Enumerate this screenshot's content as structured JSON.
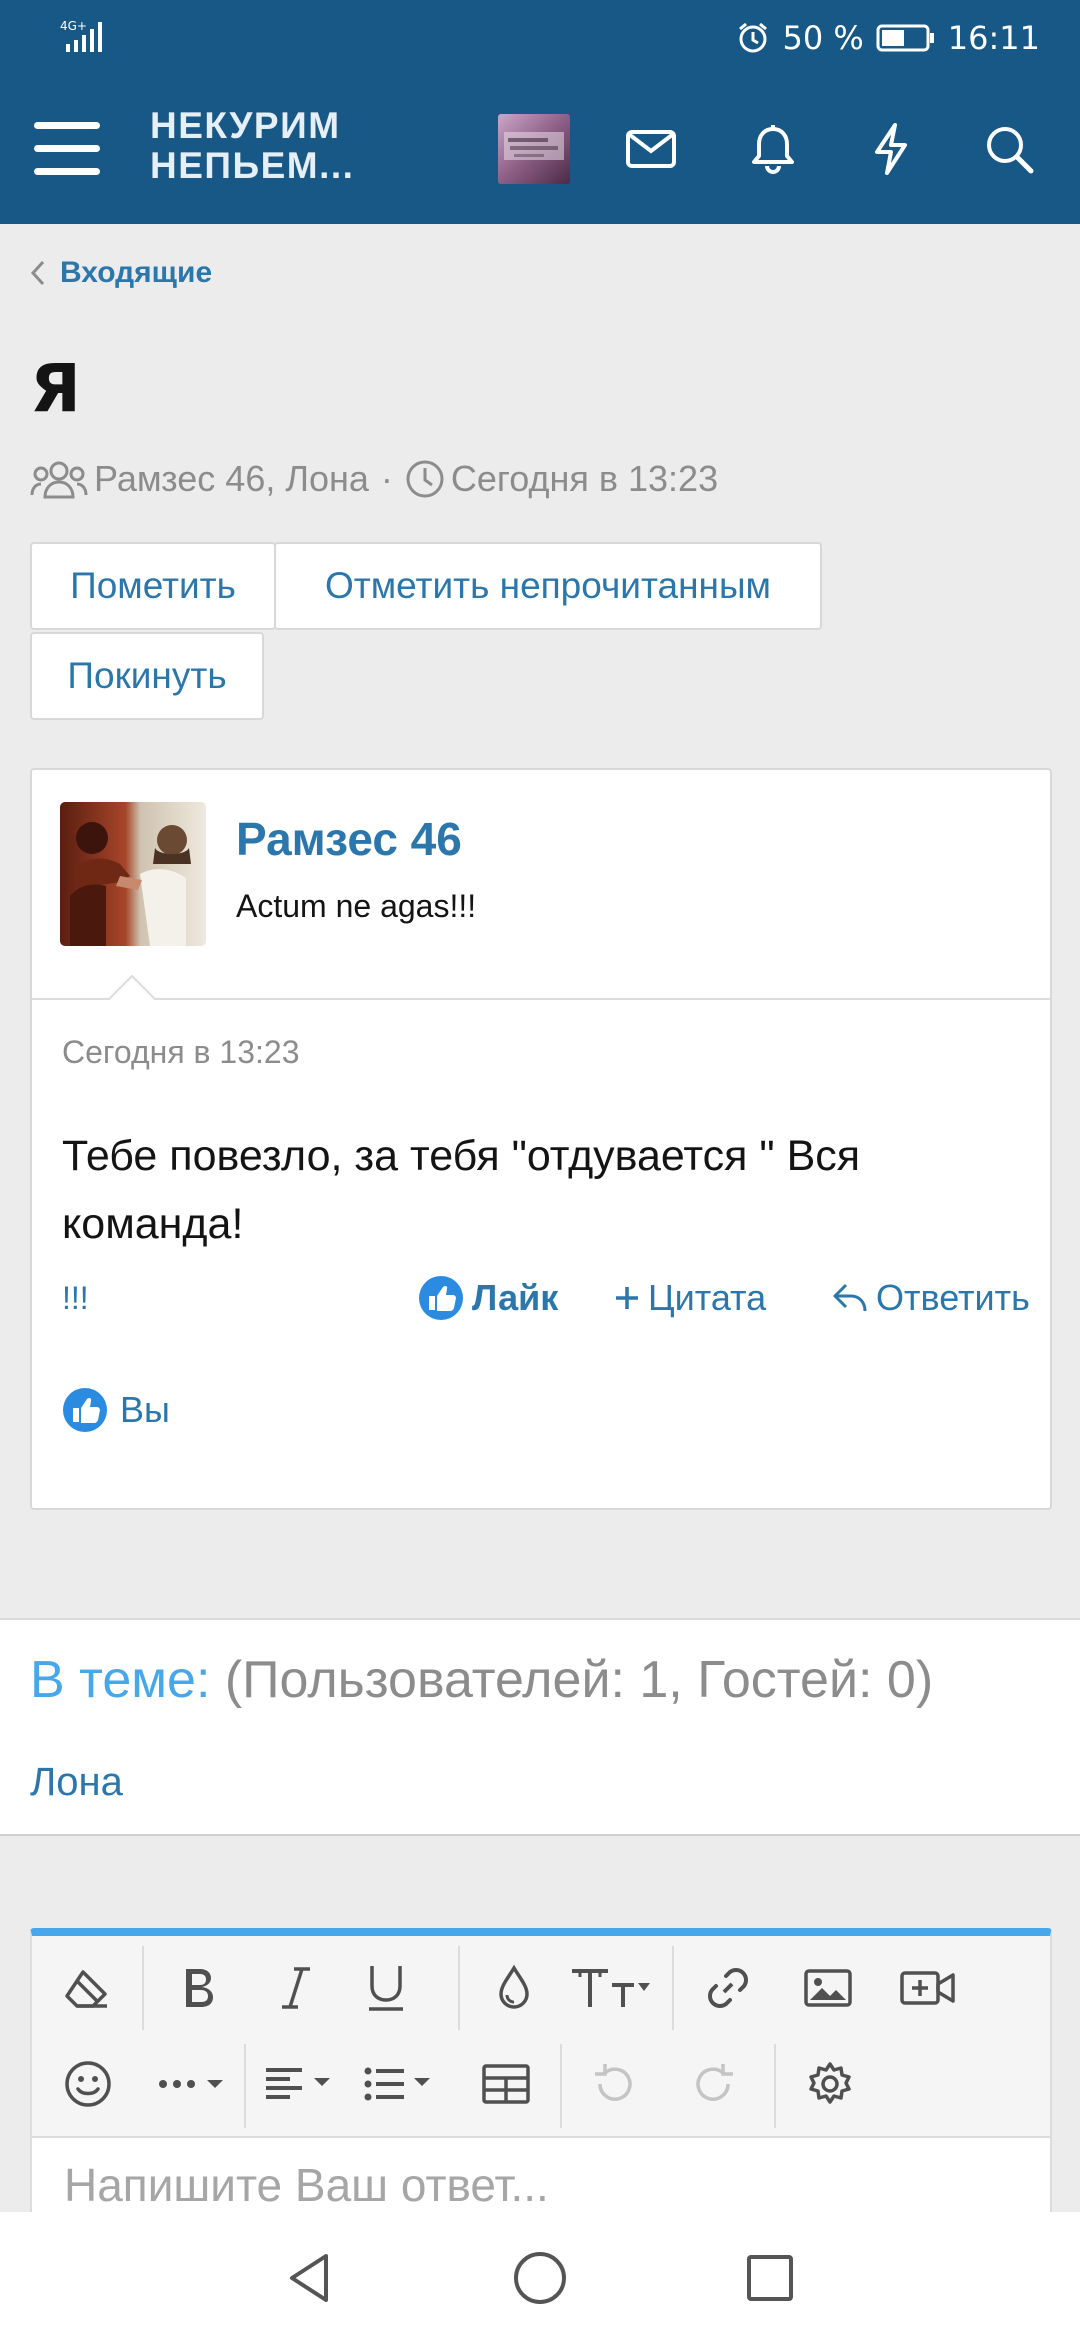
{
  "status_bar": {
    "network": "4G+",
    "battery": "50 %",
    "time": "16:11"
  },
  "header": {
    "logo_line1": "НЕКУРИМ",
    "logo_line2": "НЕПЬЕМ...",
    "icons": [
      "menu-icon",
      "mail-icon",
      "bell-icon",
      "lightning-icon",
      "search-icon"
    ],
    "colors": {
      "bar": "#185886",
      "accent": "#2b77ac",
      "highlight": "#47a7eb"
    }
  },
  "breadcrumb": {
    "label": "Входящие"
  },
  "conversation": {
    "title": "Я",
    "participants": "Рамзес 46, Лона",
    "separator": "·",
    "date": "Сегодня в 13:23"
  },
  "buttons": {
    "mark": "Пометить",
    "mark_unread": "Отметить непрочитанным",
    "leave": "Покинуть"
  },
  "message": {
    "author": "Рамзес 46",
    "author_title": "Actum ne agas!!!",
    "date": "Сегодня в 13:23",
    "body": "Тебе повезло, за тебя \"отдувается \" Вся команда!",
    "report": "!!!",
    "like": "Лайк",
    "quote": "Цитата",
    "reply": "Ответить",
    "liked_by": "Вы"
  },
  "online": {
    "label": "В теме:",
    "counts": "(Пользователей: 1, Гостей: 0)",
    "users": [
      "Лона"
    ]
  },
  "editor": {
    "placeholder": "Напишите Ваш ответ..."
  }
}
